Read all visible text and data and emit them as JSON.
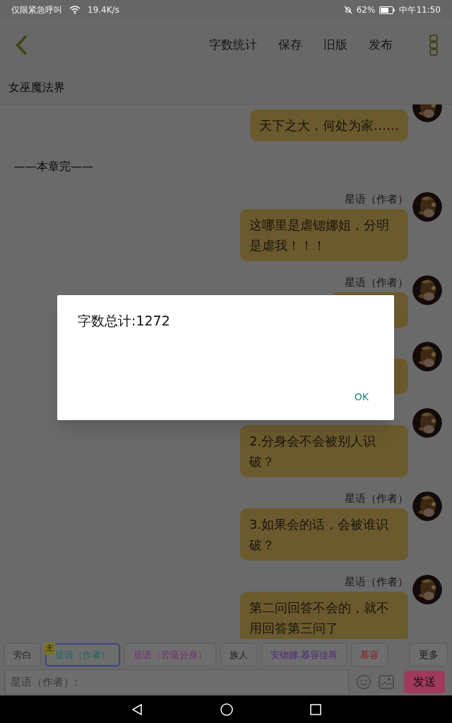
{
  "status_bar": {
    "carrier": "仅限紧急呼叫",
    "speed": "19.4K/s",
    "battery": "62%",
    "time": "中午11:50"
  },
  "toolbar": {
    "actions": [
      "字数统计",
      "保存",
      "旧版",
      "发布"
    ]
  },
  "title": "女巫魔法界",
  "chat": [
    {
      "kind": "message",
      "text": "天下之大，何处为家……"
    },
    {
      "kind": "divider",
      "text": "——本章完——"
    },
    {
      "kind": "message",
      "author": "星语（作者）",
      "text": "这哪里是虐锶娜姐，分明是虐我！！！"
    },
    {
      "kind": "message",
      "author": "星语（作者）"
    },
    {
      "kind": "message"
    },
    {
      "kind": "message",
      "text": "2.分身会不会被别人识破？"
    },
    {
      "kind": "message",
      "author": "星语（作者）",
      "text": "3.如果会的话，会被谁识破？"
    },
    {
      "kind": "message",
      "author": "星语（作者）",
      "text": "第二问回答不会的，就不用回答第三问了"
    }
  ],
  "characters": [
    {
      "label": "旁白",
      "color": "#222222",
      "selected": false
    },
    {
      "label": "星语（作者）",
      "color": "#1a6a60",
      "selected": true,
      "badge": "主"
    },
    {
      "label": "星语（苦逼分身）",
      "color": "#7a2a7a",
      "selected": false
    },
    {
      "label": "族人",
      "color": "#222222",
      "selected": false
    },
    {
      "label": "安锶娜.慕容佳苒",
      "color": "#4f2a78",
      "selected": false
    },
    {
      "label": "慕容",
      "color": "#8a1a1a",
      "selected": false
    }
  ],
  "more_button": "更多",
  "input": {
    "placeholder": "星语（作者）:"
  },
  "send_button": "发送",
  "dialog": {
    "message": "字数总计:1272",
    "button": "OK"
  }
}
